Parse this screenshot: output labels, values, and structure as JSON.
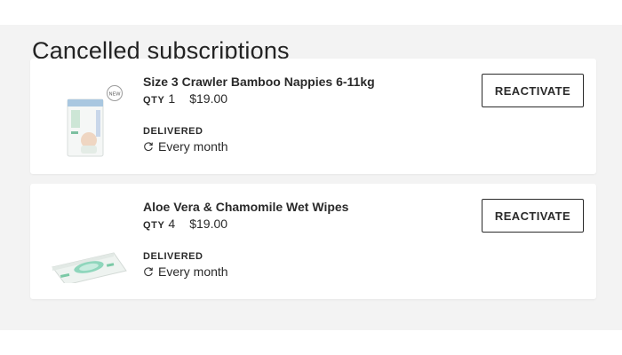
{
  "section": {
    "title": "Cancelled subscriptions"
  },
  "subscriptions": [
    {
      "name": "Size 3 Crawler Bamboo Nappies 6-11kg",
      "qty_label": "QTY",
      "qty": "1",
      "price": "$19.00",
      "status": "DELIVERED",
      "frequency": "Every month",
      "action": "REACTIVATE",
      "image": "nappies-pack-thumbnail"
    },
    {
      "name": "Aloe Vera & Chamomile Wet Wipes",
      "qty_label": "QTY",
      "qty": "4",
      "price": "$19.00",
      "status": "DELIVERED",
      "frequency": "Every month",
      "action": "REACTIVATE",
      "image": "wet-wipes-thumbnail"
    }
  ],
  "icons": {
    "frequency": "refresh-icon"
  }
}
